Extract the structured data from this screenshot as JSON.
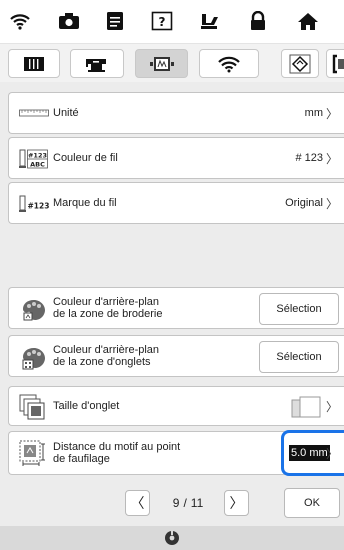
{
  "settings": {
    "unit": {
      "label": "Unité",
      "value": "mm"
    },
    "thread_color": {
      "label": "Couleur de fil",
      "value": "# 123",
      "icon_text_top": "#123",
      "icon_text_bottom": "ABC"
    },
    "thread_brand": {
      "label": "Marque du fil",
      "value": "Original",
      "icon_text": "#123"
    },
    "bg_embroidery": {
      "label_line1": "Couleur d'arrière-plan",
      "label_line2": "de la zone de broderie",
      "button": "Sélection"
    },
    "bg_tabs": {
      "label_line1": "Couleur d'arrière-plan",
      "label_line2": "de la zone d'onglets",
      "button": "Sélection"
    },
    "tab_size": {
      "label": "Taille d'onglet"
    },
    "basting": {
      "label_line1": "Distance du motif au point",
      "label_line2": "de faufilage",
      "value": "5.0 mm"
    }
  },
  "pager": {
    "current": "9",
    "separator": "/",
    "total": "11",
    "ok_label": "OK"
  },
  "colors": {
    "highlight": "#1a73e8",
    "content_bg": "#ececec",
    "active_tab": "#d3d3d3"
  }
}
